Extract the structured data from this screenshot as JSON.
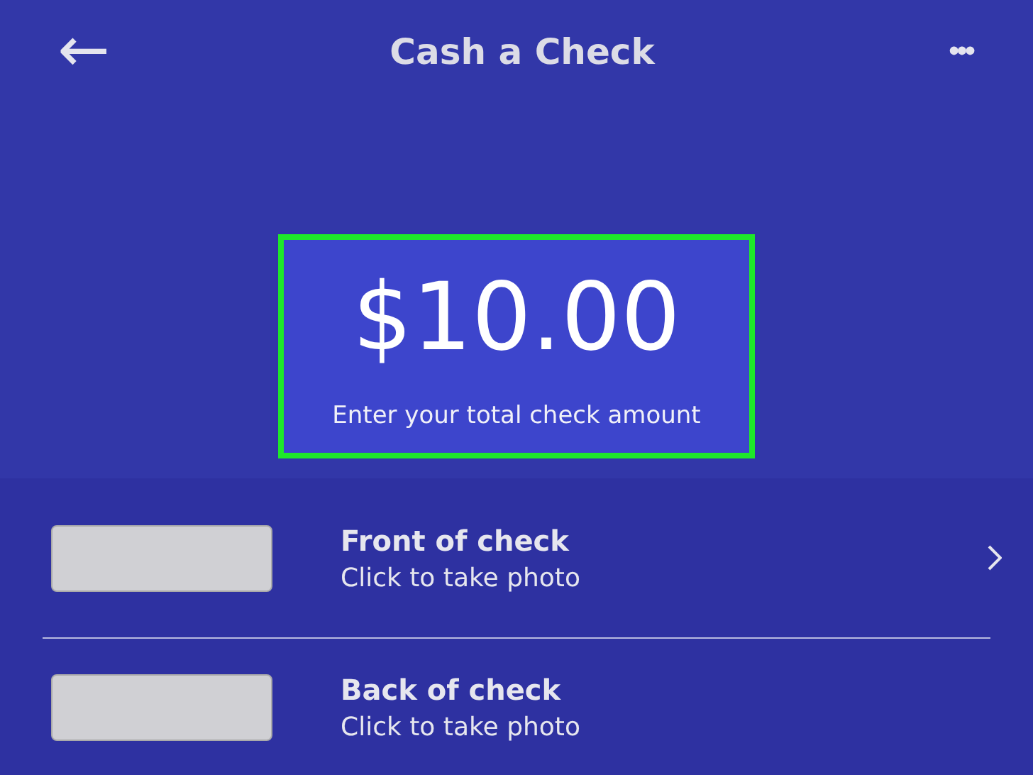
{
  "header": {
    "back": "←",
    "title": "Cash a Check",
    "more": "•••"
  },
  "amount": {
    "value": "$10.00",
    "hint": "Enter your total check amount"
  },
  "items": [
    {
      "title": "Front of check",
      "subtitle": "Click to take photo",
      "chevron": true
    },
    {
      "title": "Back of check",
      "subtitle": "Click to take photo",
      "chevron": false
    }
  ]
}
